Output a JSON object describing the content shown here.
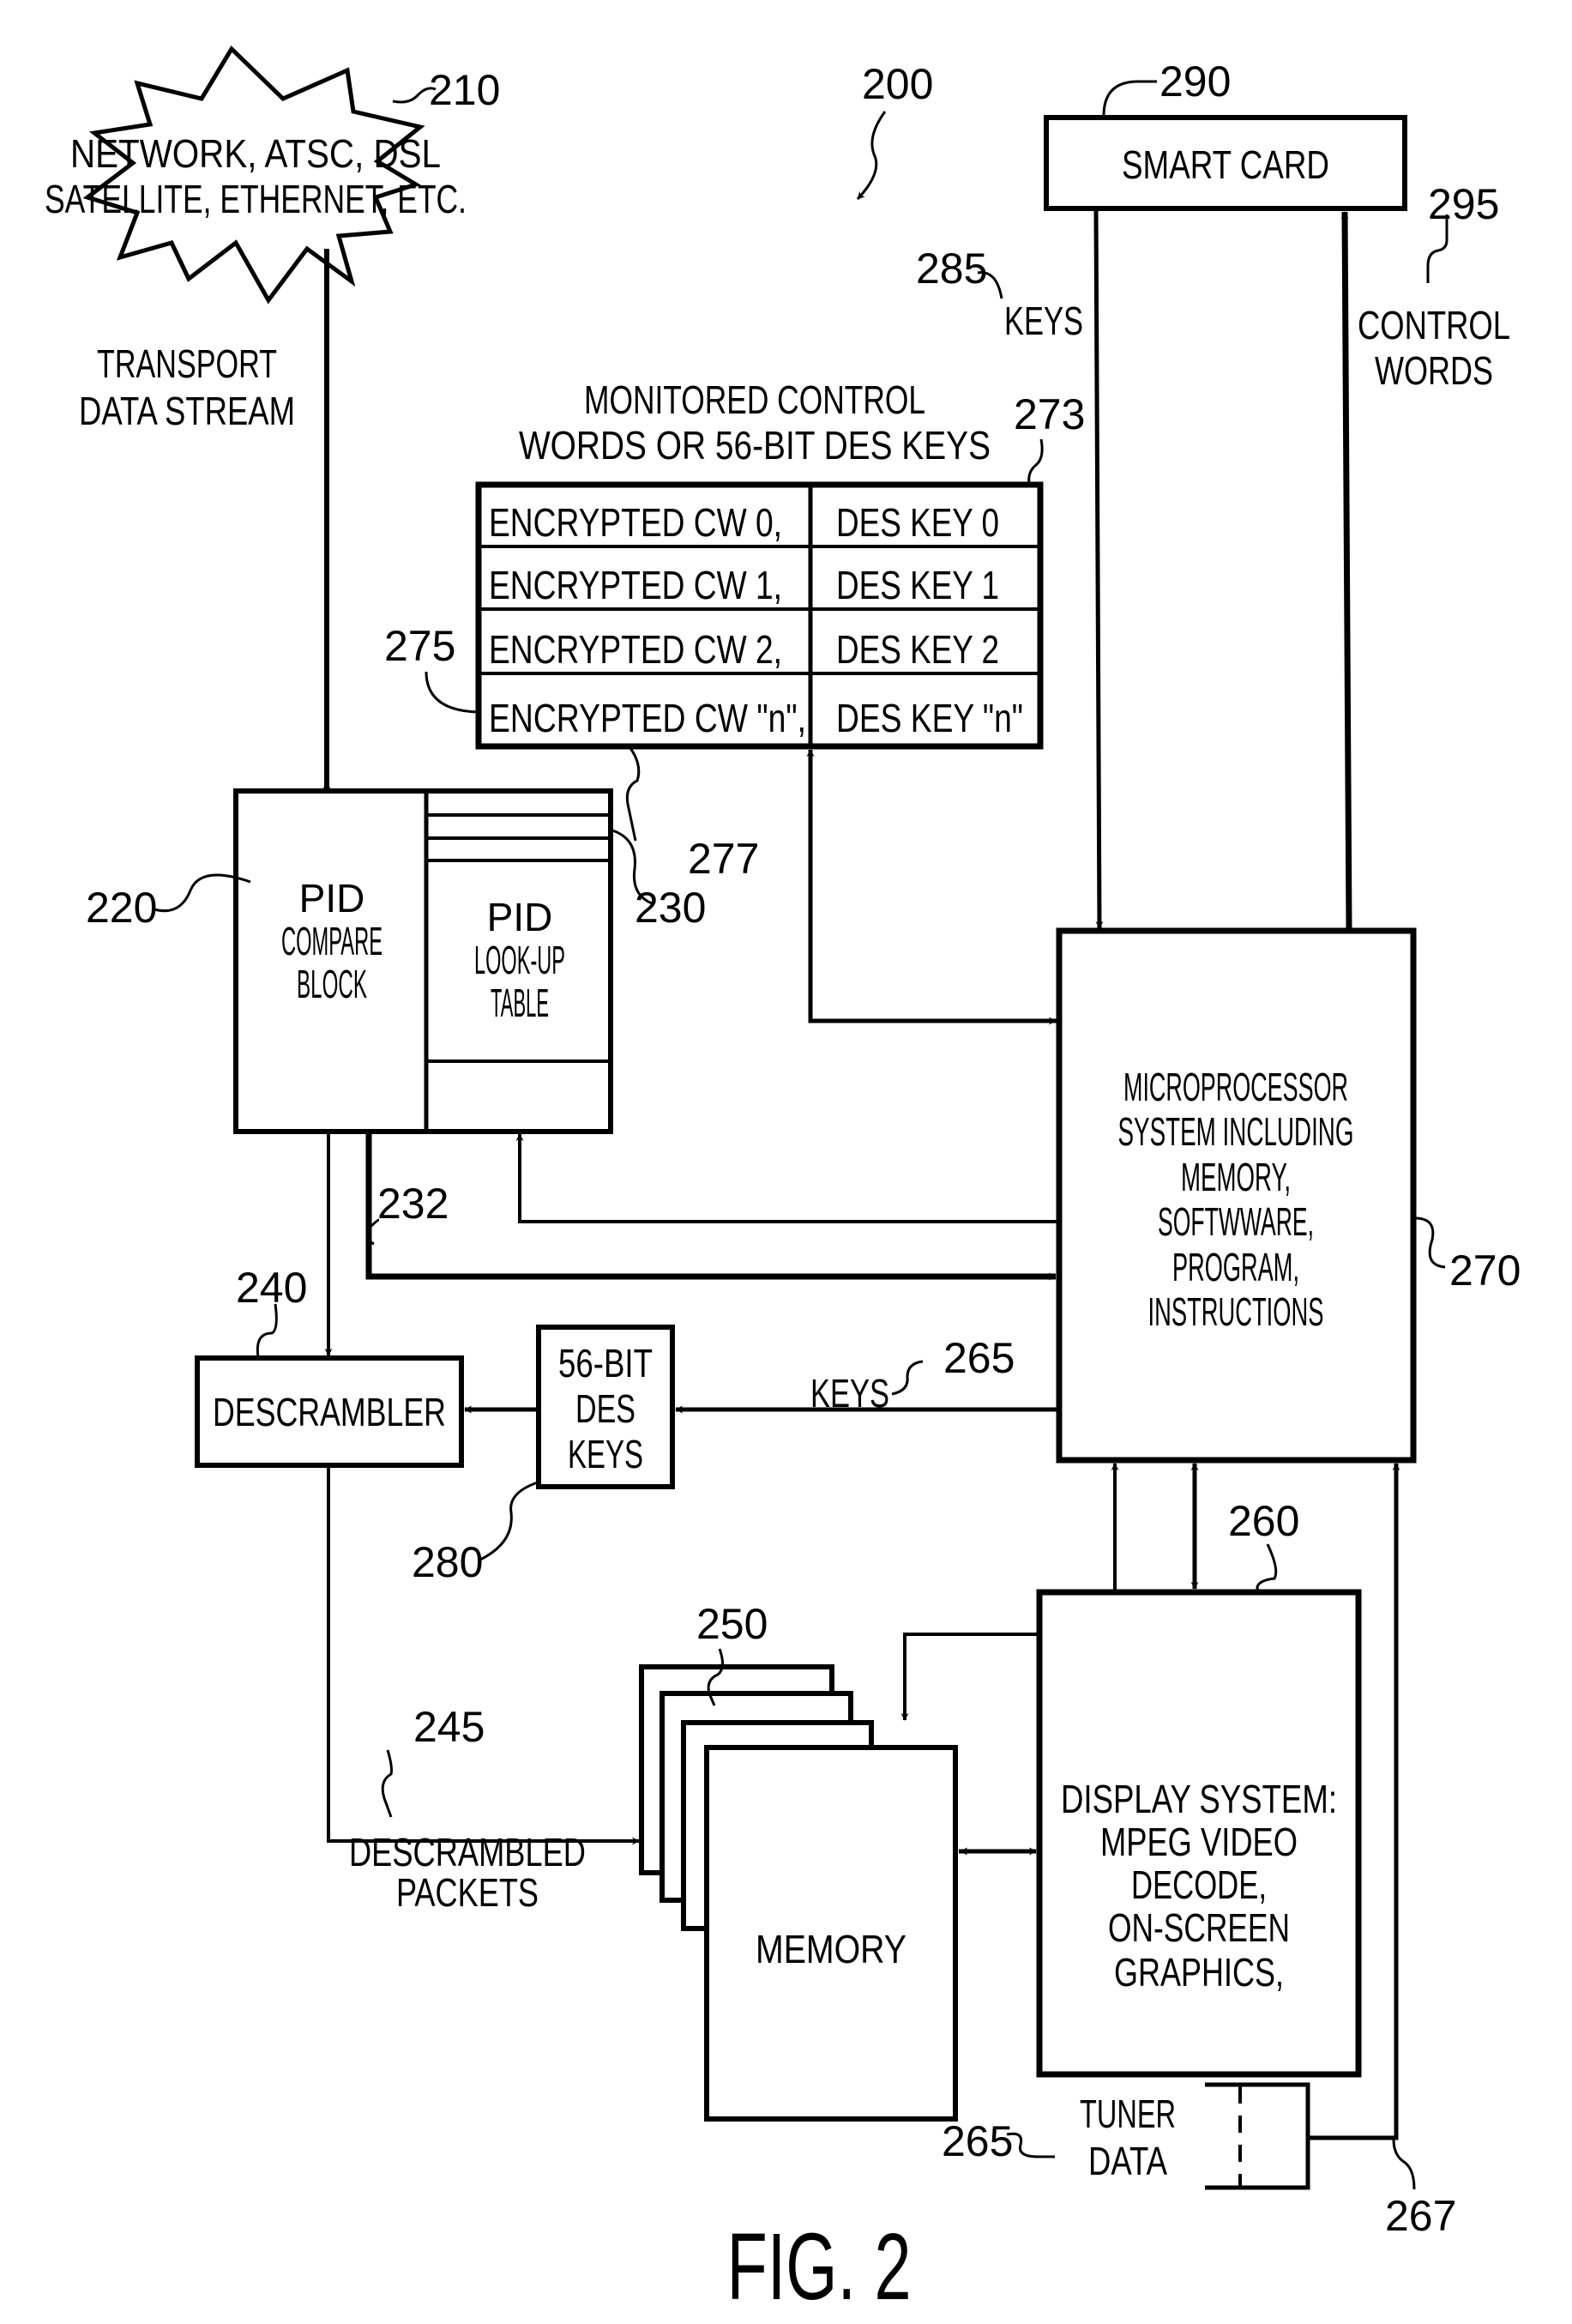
{
  "figure": {
    "title": "FIG. 2",
    "system_ref": "200"
  },
  "nodes": {
    "source": {
      "ref": "210",
      "lines": [
        "NETWORK, ATSC, DSL",
        "SATELLITE, ETHERNET, ETC."
      ]
    },
    "smart_card": {
      "ref": "290",
      "lines": [
        "SMART CARD"
      ]
    },
    "pid_compare": {
      "ref": "220",
      "lines": [
        "PID",
        "COMPARE",
        "BLOCK"
      ]
    },
    "pid_lookup": {
      "ref": "230",
      "lines": [
        "PID",
        "LOOK-UP",
        "TABLE"
      ]
    },
    "cw_table": {
      "ref": "273",
      "row_ref": "275",
      "col_ref": "277",
      "title_lines": [
        "MONITORED CONTROL",
        "WORDS OR 56-BIT DES KEYS"
      ],
      "rows": [
        {
          "cw": "ENCRYPTED CW 0,",
          "key": "DES KEY 0"
        },
        {
          "cw": "ENCRYPTED CW 1,",
          "key": "DES KEY 1"
        },
        {
          "cw": "ENCRYPTED CW 2,",
          "key": "DES KEY 2"
        },
        {
          "cw": "ENCRYPTED CW \"n\",",
          "key": "DES KEY \"n\""
        }
      ]
    },
    "microprocessor": {
      "ref": "270",
      "lines": [
        "MICROPROCESSOR",
        "SYSTEM INCLUDING",
        "MEMORY,",
        "SOFTWWARE,",
        "PROGRAM,",
        "INSTRUCTIONS"
      ]
    },
    "descrambler": {
      "ref": "240",
      "lines": [
        "DESCRAMBLER"
      ]
    },
    "des_keys": {
      "ref": "280",
      "lines": [
        "56-BIT",
        "DES",
        "KEYS"
      ]
    },
    "memory": {
      "ref": "250",
      "lines": [
        "MEMORY"
      ]
    },
    "display": {
      "ref": "260",
      "lines": [
        "DISPLAY SYSTEM:",
        "MPEG VIDEO",
        "DECODE,",
        "ON-SCREEN",
        "GRAPHICS,"
      ]
    },
    "tuner": {
      "ref": "265",
      "lines": [
        "TUNER",
        "DATA"
      ]
    }
  },
  "edges": {
    "transport": {
      "lines": [
        "TRANSPORT",
        "DATA STREAM"
      ]
    },
    "keys_from_card": {
      "ref": "285",
      "label": "KEYS"
    },
    "control_words": {
      "ref": "295",
      "lines": [
        "CONTROL",
        "WORDS"
      ]
    },
    "pid_bus": {
      "ref": "232"
    },
    "keys_to_des": {
      "ref": "265",
      "label": "KEYS"
    },
    "descrambled": {
      "ref": "245",
      "lines": [
        "DESCRAMBLED",
        "PACKETS"
      ]
    },
    "tuner_line": {
      "ref": "267"
    }
  }
}
